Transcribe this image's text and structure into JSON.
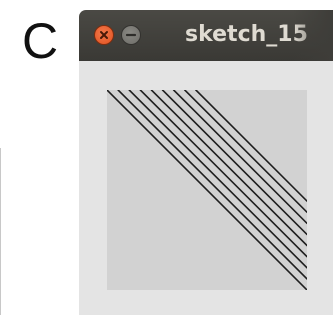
{
  "panel": {
    "letter": "C"
  },
  "window": {
    "title": "sketch_15",
    "buttons": {
      "close_icon": "close-icon",
      "minimize_icon": "minimize-icon"
    },
    "colors": {
      "titlebar": "#3e3d39",
      "close": "#e9592a",
      "minimize": "#7c7b76",
      "body": "#e4e4e4",
      "canvas": "#d2d2d2",
      "stroke": "#1e1e1e"
    }
  },
  "sketch": {
    "shape": "square-with-diagonal-lines",
    "line_count": 9
  }
}
